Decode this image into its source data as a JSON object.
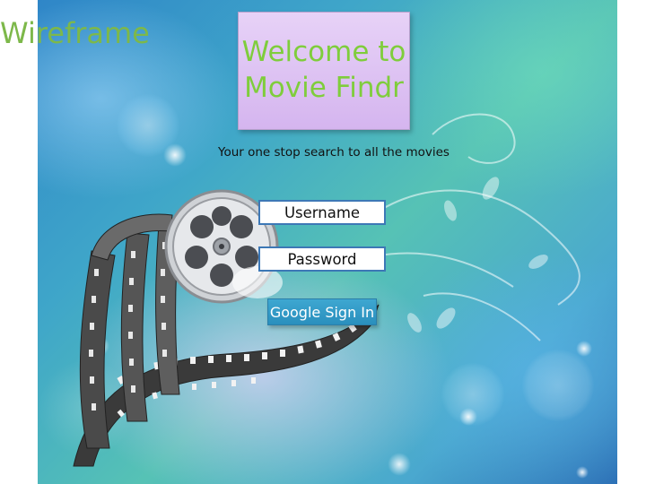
{
  "slide": {
    "label": "Wireframe"
  },
  "login": {
    "title": "Welcome to Movie Findr",
    "tagline": "Your one stop search to all the movies",
    "username_label": "Username",
    "password_label": "Password",
    "google_signin_label": "Google Sign In"
  },
  "colors": {
    "title_text": "#7fcd3c",
    "title_box": "#dcc0f2",
    "field_border": "#3d78b6",
    "google_button": "#3399c6",
    "label_green": "#7db84a"
  },
  "icons": {
    "background": "film-reel-illustration"
  }
}
